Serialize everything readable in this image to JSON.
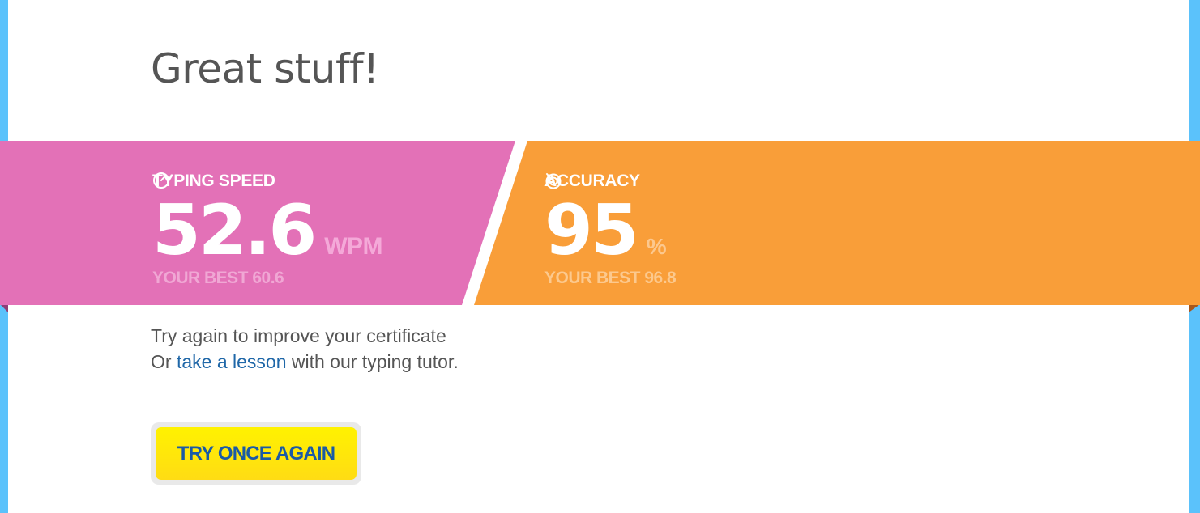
{
  "page": {
    "title": "Great stuff!",
    "colors": {
      "background_blue": "#5bc2fb",
      "speed_pink": "#e371b7",
      "accuracy_orange": "#f99e39",
      "link_blue": "#1f67a8",
      "button_yellow": "#ffe80c"
    }
  },
  "results": {
    "speed": {
      "icon": "stopwatch-icon",
      "label": "TYPING SPEED",
      "value": "52.6",
      "unit": "WPM",
      "best": "YOUR BEST 60.6"
    },
    "accuracy": {
      "icon": "target-icon",
      "label": "ACCURACY",
      "value": "95",
      "unit": "%",
      "best": "YOUR BEST 96.8"
    }
  },
  "message": {
    "line1": "Try again to improve your certificate",
    "line2_prefix": "Or ",
    "line2_link": "take a lesson",
    "line2_suffix": " with our typing tutor."
  },
  "actions": {
    "try_again_label": "TRY ONCE AGAIN"
  }
}
